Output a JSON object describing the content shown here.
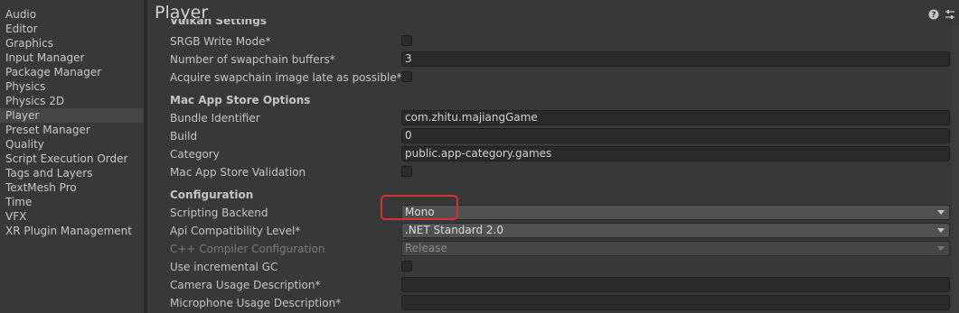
{
  "sidebar": {
    "items": [
      {
        "label": "Audio"
      },
      {
        "label": "Editor"
      },
      {
        "label": "Graphics"
      },
      {
        "label": "Input Manager"
      },
      {
        "label": "Package Manager"
      },
      {
        "label": "Physics"
      },
      {
        "label": "Physics 2D"
      },
      {
        "label": "Player"
      },
      {
        "label": "Preset Manager"
      },
      {
        "label": "Quality"
      },
      {
        "label": "Script Execution Order"
      },
      {
        "label": "Tags and Layers"
      },
      {
        "label": "TextMesh Pro"
      },
      {
        "label": "Time"
      },
      {
        "label": "VFX"
      },
      {
        "label": "XR Plugin Management"
      }
    ],
    "selected": "Player"
  },
  "header": {
    "title": "Player",
    "help_icon": "help-icon",
    "settings_icon": "preset-settings-icon"
  },
  "vulkan": {
    "section_title": "Vulkan Settings",
    "srgb_label": "SRGB Write Mode*",
    "swapchain_buffers_label": "Number of swapchain buffers*",
    "swapchain_buffers_value": "3",
    "acquire_label": "Acquire swapchain image late as possible*"
  },
  "mac_app_store": {
    "section_title": "Mac App Store Options",
    "bundle_id_label": "Bundle Identifier",
    "bundle_id_value": "com.zhitu.majiangGame",
    "build_label": "Build",
    "build_value": "0",
    "category_label": "Category",
    "category_value": "public.app-category.games",
    "validation_label": "Mac App Store Validation"
  },
  "configuration": {
    "section_title": "Configuration",
    "scripting_backend_label": "Scripting Backend",
    "scripting_backend_value": "Mono",
    "api_level_label": "Api Compatibility Level*",
    "api_level_value": ".NET Standard 2.0",
    "cpp_config_label": "C++ Compiler Configuration",
    "cpp_config_value": "Release",
    "incremental_gc_label": "Use incremental GC",
    "camera_usage_label": "Camera Usage Description*",
    "camera_usage_value": "",
    "mic_usage_label": "Microphone Usage Description*",
    "mic_usage_value": ""
  },
  "colors": {
    "highlight": "#d9302c",
    "background": "#383838",
    "field": "#2a2a2a"
  }
}
